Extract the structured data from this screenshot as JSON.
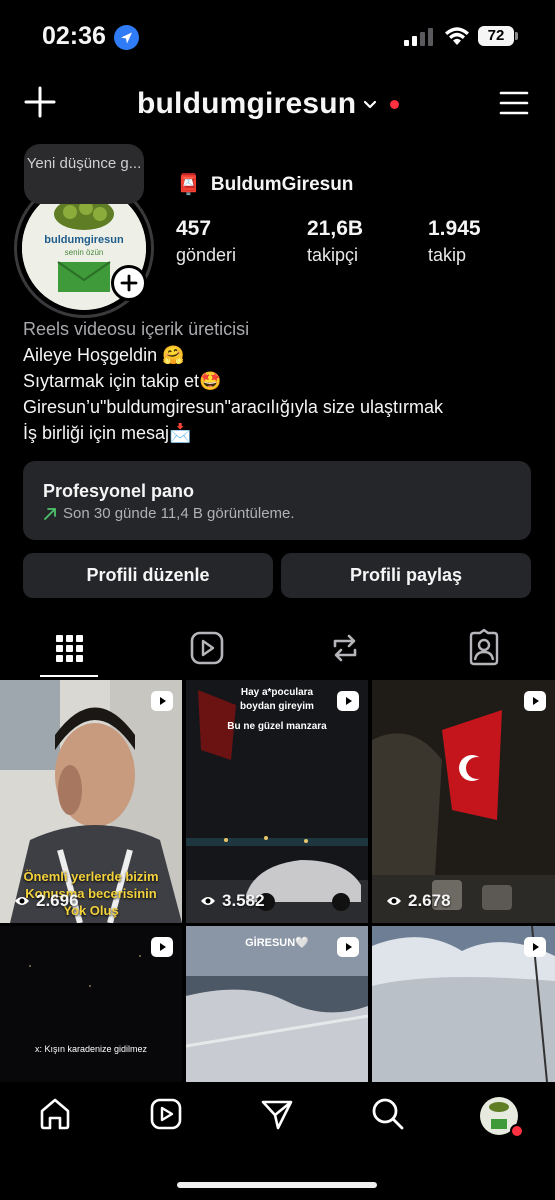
{
  "status_bar": {
    "time": "02:36",
    "battery": "72"
  },
  "header": {
    "username": "buldumgiresun"
  },
  "note": {
    "text": "Yeni düşünce g..."
  },
  "avatar": {
    "brand_name": "buldumgiresun",
    "brand_tag": "senin özün"
  },
  "profile": {
    "display_name": "BuldumGiresun",
    "name_emoji": "📮",
    "stats": [
      {
        "value": "457",
        "label": "gönderi"
      },
      {
        "value": "21,6B",
        "label": "takipçi"
      },
      {
        "value": "1.945",
        "label": "takip"
      }
    ],
    "bio": {
      "category": "Reels videosu içerik üreticisi",
      "lines": [
        "Aileye Hoşgeldin 🤗",
        "Sıytarmak için takip et🤩",
        "Giresun’u\"buldumgiresun\"aracılığıyla size ulaştırmak",
        "İş birliği için mesaj📩"
      ]
    }
  },
  "pro_panel": {
    "title": "Profesyonel pano",
    "subtitle": "Son 30 günde 11,4 B görüntüleme."
  },
  "buttons": {
    "edit": "Profili düzenle",
    "share": "Profili paylaş"
  },
  "tabs": [
    "grid-icon",
    "reels-icon",
    "reposts-icon",
    "tagged-icon"
  ],
  "grid": [
    {
      "views": "2.696",
      "caption_lines": [
        "Önemli yerlerde bizim",
        "Konuşma becerisinin",
        "Yok Oluş"
      ]
    },
    {
      "views": "3.582",
      "caption_lines": [
        "Hay a*poculara",
        "boydan gireyim",
        "Bu ne güzel manzara"
      ]
    },
    {
      "views": "2.678",
      "caption_lines": []
    },
    {
      "views": "",
      "caption_lines": [
        "x: Kışın karadenize gidilmez"
      ]
    },
    {
      "views": "",
      "caption_lines": [
        "GİRESUN🤍"
      ]
    },
    {
      "views": "",
      "caption_lines": []
    }
  ],
  "bottom_nav": [
    "home-icon",
    "reels-icon",
    "direct-icon",
    "search-icon",
    "profile-avatar"
  ]
}
